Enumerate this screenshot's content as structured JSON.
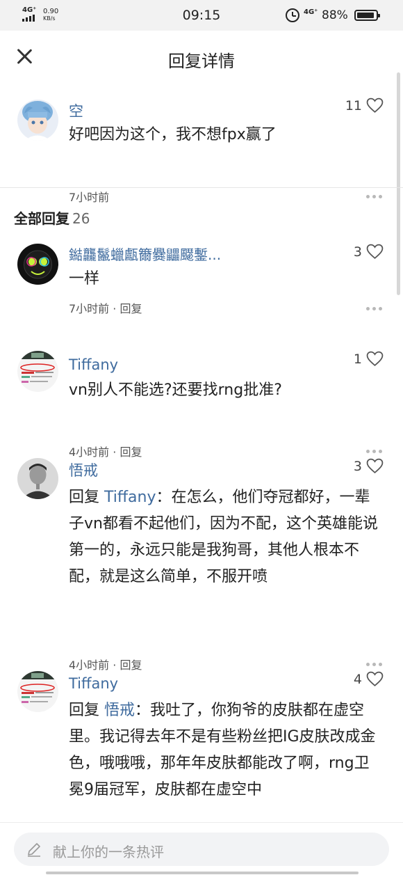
{
  "status_bar": {
    "network": "4G⁺",
    "speed_value": "0.90",
    "speed_unit": "KB/s",
    "time": "09:15",
    "network2": "4G⁺",
    "battery": "88%"
  },
  "header": {
    "title": "回复详情"
  },
  "main_comment": {
    "name": "空",
    "text": "好吧因为这个，我不想fpx赢了",
    "likes": "11",
    "time": "7小时前"
  },
  "replies_section": {
    "label": "全部回复",
    "count": "26"
  },
  "replies": [
    {
      "name": "鐑龘鬣蠟甗籋爨鼺飋鏨...",
      "text": "一样",
      "likes": "3",
      "meta": "7小时前 · 回复"
    },
    {
      "name": "Tiffany",
      "text": "vn别人不能选?还要找rng批准?",
      "likes": "1",
      "meta": "4小时前 · 回复"
    },
    {
      "name": "悟戒",
      "reply_prefix": "回复 ",
      "reply_to": "Tiffany",
      "text": "：在怎么，他们夺冠都好，一辈子vn都看不起他们，因为不配，这个英雄能说第一的，永远只能是我狗哥，其他人根本不配，就是这么简单，不服开喷",
      "likes": "3",
      "meta": "4小时前 · 回复"
    },
    {
      "name": "Tiffany",
      "reply_prefix": "回复 ",
      "reply_to": "悟戒",
      "text": "：我吐了，你狗爷的皮肤都在虚空里。我记得去年不是有些粉丝把IG皮肤改成金色，哦哦哦，那年年皮肤都能改了啊，rng卫冕9届冠军，皮肤都在虚空中",
      "likes": "4"
    }
  ],
  "footer": {
    "placeholder": "献上你的一条热评"
  },
  "colors": {
    "accent": "#3f6b9e",
    "text": "#222222",
    "muted": "#555555"
  },
  "icons": [
    "close-icon",
    "heart-icon",
    "more-icon",
    "pencil-icon",
    "alarm-icon",
    "battery-icon",
    "signal-icon"
  ]
}
